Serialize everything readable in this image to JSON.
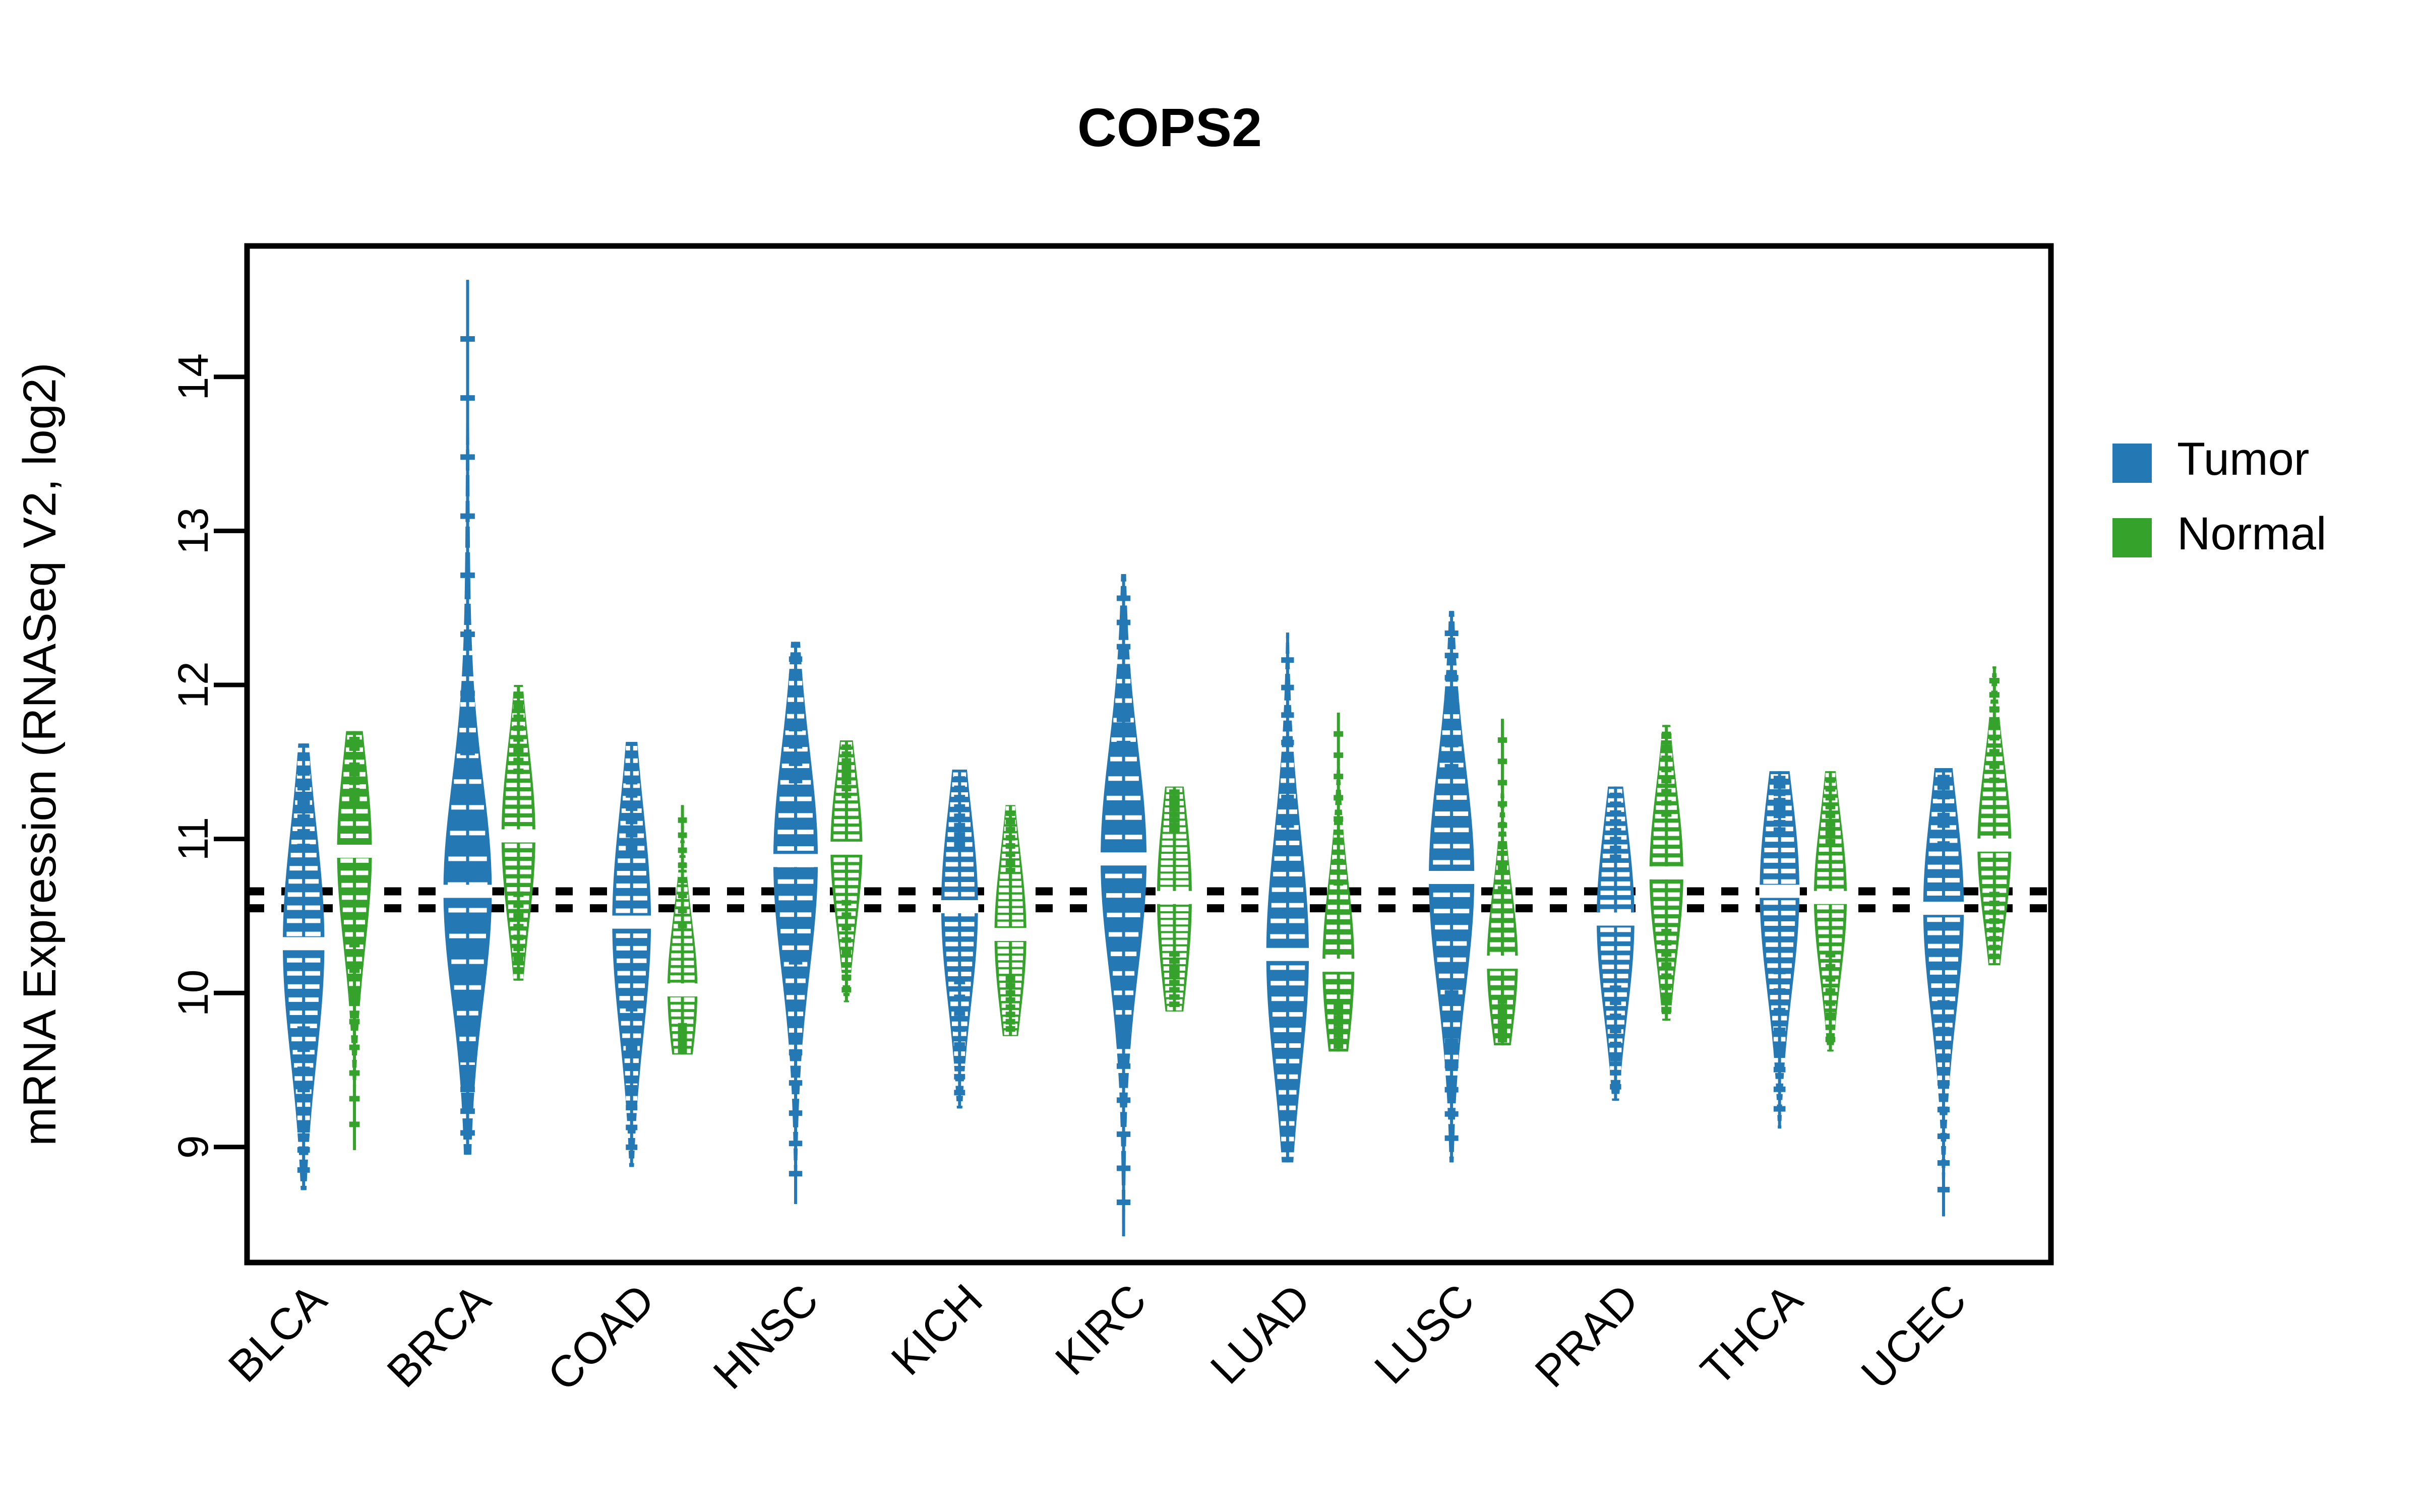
{
  "chart_data": {
    "type": "violin",
    "title": "COPS2",
    "xlabel": "",
    "ylabel": "mRNA Expression (RNASeq V2, log2)",
    "ylim": [
      8.25,
      14.85
    ],
    "yticks": [
      9,
      10,
      11,
      12,
      13,
      14
    ],
    "ytick_labels": [
      "9",
      "10",
      "11",
      "12",
      "13",
      "14"
    ],
    "grid": false,
    "legend_position": "right",
    "categories": [
      "BLCA",
      "BRCA",
      "COAD",
      "HNSC",
      "KICH",
      "KIRC",
      "LUAD",
      "LUSC",
      "PRAD",
      "THCA",
      "UCEC"
    ],
    "reference_lines": [
      10.66,
      10.55
    ],
    "series": [
      {
        "name": "Tumor",
        "color": "#2479b5",
        "stats": [
          {
            "category": "BLCA",
            "median": 10.32,
            "q1": 9.95,
            "q3": 10.72,
            "min": 8.72,
            "max": 11.62,
            "width": 0.86
          },
          {
            "category": "BRCA",
            "median": 10.66,
            "q1": 10.28,
            "q3": 11.02,
            "min": 8.95,
            "max": 14.63,
            "width": 1.0
          },
          {
            "category": "COAD",
            "median": 10.46,
            "q1": 10.08,
            "q3": 10.82,
            "min": 8.87,
            "max": 11.63,
            "width": 0.8
          },
          {
            "category": "HNSC",
            "median": 10.86,
            "q1": 10.48,
            "q3": 11.22,
            "min": 8.63,
            "max": 12.28,
            "width": 0.92
          },
          {
            "category": "KICH",
            "median": 10.56,
            "q1": 10.22,
            "q3": 10.88,
            "min": 9.25,
            "max": 11.45,
            "width": 0.76
          },
          {
            "category": "KIRC",
            "median": 10.87,
            "q1": 10.5,
            "q3": 11.24,
            "min": 8.42,
            "max": 12.72,
            "width": 0.95
          },
          {
            "category": "LUAD",
            "median": 10.25,
            "q1": 9.86,
            "q3": 10.66,
            "min": 8.9,
            "max": 12.34,
            "width": 0.88
          },
          {
            "category": "LUSC",
            "median": 10.75,
            "q1": 10.38,
            "q3": 11.12,
            "min": 8.9,
            "max": 12.48,
            "width": 0.94
          },
          {
            "category": "PRAD",
            "median": 10.48,
            "q1": 10.16,
            "q3": 10.8,
            "min": 9.3,
            "max": 11.34,
            "width": 0.78
          },
          {
            "category": "THCA",
            "median": 10.66,
            "q1": 10.32,
            "q3": 10.99,
            "min": 9.12,
            "max": 11.44,
            "width": 0.82
          },
          {
            "category": "UCEC",
            "median": 10.55,
            "q1": 10.18,
            "q3": 10.88,
            "min": 8.55,
            "max": 11.46,
            "width": 0.84
          }
        ]
      },
      {
        "name": "Normal",
        "color": "#35a32b",
        "stats": [
          {
            "category": "BLCA",
            "median": 10.92,
            "q1": 10.55,
            "q3": 11.18,
            "min": 8.98,
            "max": 11.7,
            "width": 0.72
          },
          {
            "category": "BRCA",
            "median": 11.02,
            "q1": 10.74,
            "q3": 11.34,
            "min": 10.08,
            "max": 12.0,
            "width": 0.7
          },
          {
            "category": "COAD",
            "median": 10.02,
            "q1": 9.82,
            "q3": 10.3,
            "min": 9.6,
            "max": 11.22,
            "width": 0.62
          },
          {
            "category": "HNSC",
            "median": 10.94,
            "q1": 10.7,
            "q3": 11.22,
            "min": 9.94,
            "max": 11.64,
            "width": 0.66
          },
          {
            "category": "KICH",
            "median": 10.38,
            "q1": 10.16,
            "q3": 10.72,
            "min": 9.72,
            "max": 11.22,
            "width": 0.66
          },
          {
            "category": "KIRC",
            "median": 10.62,
            "q1": 10.32,
            "q3": 11.0,
            "min": 9.88,
            "max": 11.34,
            "width": 0.72
          },
          {
            "category": "LUAD",
            "median": 10.18,
            "q1": 9.96,
            "q3": 10.52,
            "min": 9.62,
            "max": 11.82,
            "width": 0.66
          },
          {
            "category": "LUSC",
            "median": 10.2,
            "q1": 10.0,
            "q3": 10.48,
            "min": 9.66,
            "max": 11.78,
            "width": 0.64
          },
          {
            "category": "PRAD",
            "median": 10.78,
            "q1": 10.5,
            "q3": 11.06,
            "min": 9.82,
            "max": 11.74,
            "width": 0.7
          },
          {
            "category": "THCA",
            "median": 10.62,
            "q1": 10.36,
            "q3": 10.9,
            "min": 9.62,
            "max": 11.44,
            "width": 0.68
          },
          {
            "category": "UCEC",
            "median": 10.96,
            "q1": 10.72,
            "q3": 11.25,
            "min": 10.18,
            "max": 12.12,
            "width": 0.7
          }
        ]
      }
    ]
  },
  "legend": {
    "items": [
      {
        "label": "Tumor",
        "color": "#2479b5"
      },
      {
        "label": "Normal",
        "color": "#35a32b"
      }
    ]
  },
  "axis": {
    "y_title": "mRNA Expression (RNASeq V2, log2)"
  },
  "title": "COPS2"
}
